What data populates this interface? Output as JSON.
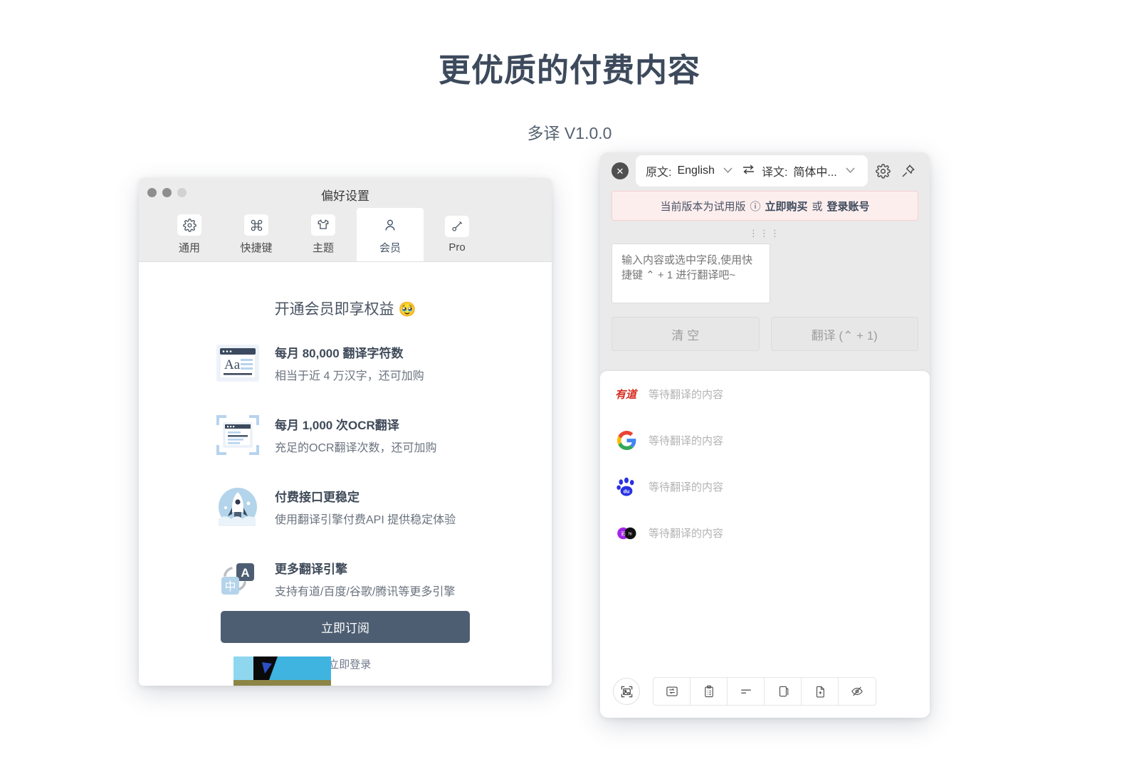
{
  "header": {
    "title": "更优质的付费内容",
    "subtitle": "多译 V1.0.0"
  },
  "prefs_window": {
    "window_title": "偏好设置",
    "traffic_lights": [
      "close",
      "minimize",
      "zoom"
    ],
    "tabs": [
      {
        "label": "通用",
        "icon": "gear-icon",
        "active": false
      },
      {
        "label": "快捷键",
        "icon": "command-icon",
        "active": false
      },
      {
        "label": "主题",
        "icon": "shirt-icon",
        "active": false
      },
      {
        "label": "会员",
        "icon": "person-icon",
        "active": true
      },
      {
        "label": "Pro",
        "icon": "brush-icon",
        "active": false
      }
    ],
    "benefits_heading": "开通会员即享权益",
    "benefits_emoji": "🥹",
    "features": [
      {
        "icon": "text-window-icon",
        "title": "每月 80,000 翻译字符数",
        "desc": "相当于近 4 万汉字，还可加购"
      },
      {
        "icon": "ocr-scan-icon",
        "title": "每月 1,000 次OCR翻译",
        "desc": "充足的OCR翻译次数，还可加购"
      },
      {
        "icon": "rocket-icon",
        "title": "付费接口更稳定",
        "desc": "使用翻译引擎付费API 提供稳定体验"
      },
      {
        "icon": "translate-icon",
        "title": "更多翻译引擎",
        "desc": "支持有道/百度/谷歌/腾讯等更多引擎"
      }
    ],
    "subscribe_label": "立即订阅",
    "login_prefix": "?",
    "login_link": "立即登录"
  },
  "translator": {
    "close_icon": "close-icon",
    "source_label": "原文:",
    "source_value": "English",
    "swap_icon": "swap-languages-icon",
    "target_label": "译文:",
    "target_value": "简体中...",
    "settings_icon": "gear-icon",
    "pin_icon": "pin-icon",
    "banner": {
      "text": "当前版本为试用版",
      "info_icon": "ⓘ",
      "buy_label": "立即购买",
      "or_label": "或",
      "login_label": "登录账号"
    },
    "grip": "⋮⋮⋮",
    "input_placeholder": "输入内容或选中字段,使用快捷键 ⌃ + 1 进行翻译吧~",
    "input_value": "",
    "clear_label": "清 空",
    "translate_label": "翻译 (⌃ + 1)",
    "results": [
      {
        "engine": "youdao-icon",
        "engine_name": "有道",
        "text": "等待翻译的内容"
      },
      {
        "engine": "google-icon",
        "engine_name": "Google",
        "text": "等待翻译的内容"
      },
      {
        "engine": "baidu-icon",
        "engine_name": "百度",
        "text": "等待翻译的内容"
      },
      {
        "engine": "caiyun-icon",
        "engine_name": "彩云",
        "text": "等待翻译的内容"
      }
    ],
    "bottom_tools": {
      "ocr_button": "screenshot-ocr-icon",
      "items": [
        "auto-translate-icon",
        "clipboard-icon",
        "compare-text-icon",
        "copy-document-icon",
        "add-document-icon",
        "hide-eye-icon"
      ]
    }
  },
  "colors": {
    "title": "#3d4a5c",
    "accent": "#4e5e72",
    "banner_bg": "#fdeeee",
    "banner_border": "#f6cfcf",
    "panel_bg": "#eaeaea"
  }
}
